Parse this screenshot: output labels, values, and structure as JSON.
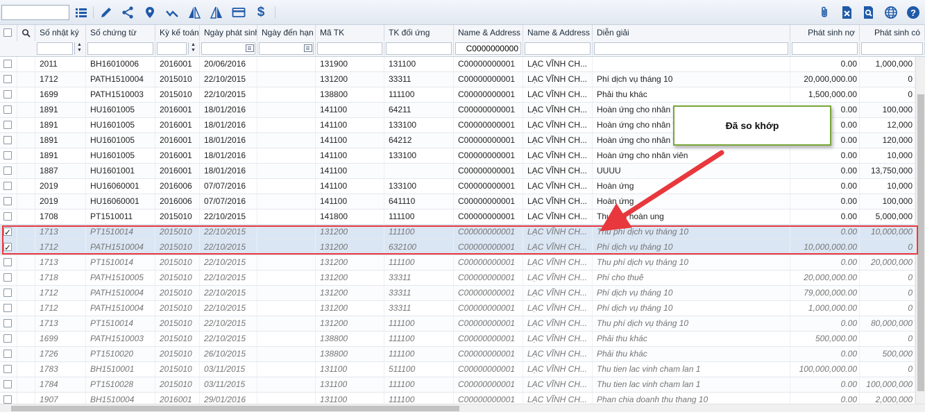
{
  "toolbar": {
    "search_value": "",
    "left_icons": [
      "list-icon",
      "edit-icon",
      "share-icon",
      "map-marker-icon",
      "check-mark-icon",
      "flip-left-icon",
      "flip-right-icon",
      "credit-card-icon",
      "dollar-icon"
    ],
    "right_icons": [
      "paperclip-icon",
      "excel-export-icon",
      "search-document-icon",
      "globe-icon",
      "help-icon"
    ]
  },
  "columns": {
    "so_nhat_ky": "Số nhật ký",
    "so_chung_tu": "Số chứng từ",
    "ky_ke_toan": "Kỳ kế toán",
    "ngay_phat_sinh": "Ngày phát sinh",
    "ngay_den_han": "Ngày đến hạn",
    "ma_tk": "Mã TK",
    "tk_doi_ung": "TK đối ứng",
    "name_address_1": "Name & Address",
    "name_address_2": "Name & Address",
    "dien_giai": "Diễn giải",
    "phat_sinh_no": "Phát sinh nợ",
    "phat_sinh_co": "Phát sinh có"
  },
  "filters": {
    "name_address_1": "C0000000000"
  },
  "rows": [
    {
      "checked": false,
      "faded": false,
      "nk": "2011",
      "ct": "BH16010006",
      "kkt": "2016001",
      "nps": "20/06/2016",
      "tk": "131900",
      "du": "131100",
      "na1": "C00000000001",
      "na2": "LẠC VĨNH CH...",
      "dg": "",
      "no": "0.00",
      "co": "1,000,000"
    },
    {
      "checked": false,
      "faded": false,
      "nk": "1712",
      "ct": "PATH1510004",
      "kkt": "2015010",
      "nps": "22/10/2015",
      "tk": "131200",
      "du": "33311",
      "na1": "C00000000001",
      "na2": "LẠC VĨNH CH...",
      "dg": "Phí dịch vụ tháng 10",
      "no": "20,000,000.00",
      "co": "0"
    },
    {
      "checked": false,
      "faded": false,
      "nk": "1699",
      "ct": "PATH1510003",
      "kkt": "2015010",
      "nps": "22/10/2015",
      "tk": "138800",
      "du": "111100",
      "na1": "C00000000001",
      "na2": "LẠC VĨNH CH...",
      "dg": "Phải thu khác",
      "no": "1,500,000.00",
      "co": "0"
    },
    {
      "checked": false,
      "faded": false,
      "nk": "1891",
      "ct": "HU1601005",
      "kkt": "2016001",
      "nps": "18/01/2016",
      "tk": "141100",
      "du": "64211",
      "na1": "C00000000001",
      "na2": "LẠC VĨNH CH...",
      "dg": "Hoàn ứng cho nhân viên",
      "no": "0.00",
      "co": "100,000"
    },
    {
      "checked": false,
      "faded": false,
      "nk": "1891",
      "ct": "HU1601005",
      "kkt": "2016001",
      "nps": "18/01/2016",
      "tk": "141100",
      "du": "133100",
      "na1": "C00000000001",
      "na2": "LẠC VĨNH CH...",
      "dg": "Hoàn ứng cho nhân viên",
      "no": "0.00",
      "co": "12,000"
    },
    {
      "checked": false,
      "faded": false,
      "nk": "1891",
      "ct": "HU1601005",
      "kkt": "2016001",
      "nps": "18/01/2016",
      "tk": "141100",
      "du": "64212",
      "na1": "C00000000001",
      "na2": "LẠC VĨNH CH...",
      "dg": "Hoàn ứng cho nhân viên",
      "no": "0.00",
      "co": "120,000"
    },
    {
      "checked": false,
      "faded": false,
      "nk": "1891",
      "ct": "HU1601005",
      "kkt": "2016001",
      "nps": "18/01/2016",
      "tk": "141100",
      "du": "133100",
      "na1": "C00000000001",
      "na2": "LẠC VĨNH CH...",
      "dg": "Hoàn ứng cho nhân viên",
      "no": "0.00",
      "co": "10,000"
    },
    {
      "checked": false,
      "faded": false,
      "nk": "1887",
      "ct": "HU1601001",
      "kkt": "2016001",
      "nps": "18/01/2016",
      "tk": "141100",
      "du": "",
      "na1": "C00000000001",
      "na2": "LẠC VĨNH CH...",
      "dg": "UUUU",
      "no": "0.00",
      "co": "13,750,000"
    },
    {
      "checked": false,
      "faded": false,
      "nk": "2019",
      "ct": "HU16060001",
      "kkt": "2016006",
      "nps": "07/07/2016",
      "tk": "141100",
      "du": "133100",
      "na1": "C00000000001",
      "na2": "LẠC VĨNH CH...",
      "dg": "Hoàn ứng",
      "no": "0.00",
      "co": "10,000"
    },
    {
      "checked": false,
      "faded": false,
      "nk": "2019",
      "ct": "HU16060001",
      "kkt": "2016006",
      "nps": "07/07/2016",
      "tk": "141100",
      "du": "641110",
      "na1": "C00000000001",
      "na2": "LẠC VĨNH CH...",
      "dg": "Hoàn ứng",
      "no": "0.00",
      "co": "100,000"
    },
    {
      "checked": false,
      "faded": false,
      "nk": "1708",
      "ct": "PT1510011",
      "kkt": "2015010",
      "nps": "22/10/2015",
      "tk": "141800",
      "du": "111100",
      "na1": "C00000000001",
      "na2": "LẠC VĨNH CH...",
      "dg": "Thu tiền hoàn ung",
      "no": "0.00",
      "co": "5,000,000"
    },
    {
      "checked": true,
      "faded": true,
      "nk": "1713",
      "ct": "PT1510014",
      "kkt": "2015010",
      "nps": "22/10/2015",
      "tk": "131200",
      "du": "111100",
      "na1": "C00000000001",
      "na2": "LẠC VĨNH CH...",
      "dg": "Thu phí dịch vụ tháng 10",
      "no": "0.00",
      "co": "10,000,000"
    },
    {
      "checked": true,
      "faded": true,
      "nk": "1712",
      "ct": "PATH1510004",
      "kkt": "2015010",
      "nps": "22/10/2015",
      "tk": "131200",
      "du": "632100",
      "na1": "C00000000001",
      "na2": "LẠC VĨNH CH...",
      "dg": "Phí dịch vụ tháng 10",
      "no": "10,000,000.00",
      "co": "0"
    },
    {
      "checked": false,
      "faded": true,
      "nk": "1713",
      "ct": "PT1510014",
      "kkt": "2015010",
      "nps": "22/10/2015",
      "tk": "131200",
      "du": "111100",
      "na1": "C00000000001",
      "na2": "LẠC VĨNH CH...",
      "dg": "Thu phí dịch vụ tháng 10",
      "no": "0.00",
      "co": "20,000,000"
    },
    {
      "checked": false,
      "faded": true,
      "nk": "1718",
      "ct": "PATH1510005",
      "kkt": "2015010",
      "nps": "22/10/2015",
      "tk": "131200",
      "du": "33311",
      "na1": "C00000000001",
      "na2": "LẠC VĨNH CH...",
      "dg": "Phí cho thuê",
      "no": "20,000,000.00",
      "co": "0"
    },
    {
      "checked": false,
      "faded": true,
      "nk": "1712",
      "ct": "PATH1510004",
      "kkt": "2015010",
      "nps": "22/10/2015",
      "tk": "131200",
      "du": "33311",
      "na1": "C00000000001",
      "na2": "LẠC VĨNH CH...",
      "dg": "Phí dịch vụ tháng 10",
      "no": "79,000,000.00",
      "co": "0"
    },
    {
      "checked": false,
      "faded": true,
      "nk": "1712",
      "ct": "PATH1510004",
      "kkt": "2015010",
      "nps": "22/10/2015",
      "tk": "131200",
      "du": "33311",
      "na1": "C00000000001",
      "na2": "LẠC VĨNH CH...",
      "dg": "Phí dịch vụ tháng 10",
      "no": "1,000,000.00",
      "co": "0"
    },
    {
      "checked": false,
      "faded": true,
      "nk": "1713",
      "ct": "PT1510014",
      "kkt": "2015010",
      "nps": "22/10/2015",
      "tk": "131200",
      "du": "111100",
      "na1": "C00000000001",
      "na2": "LẠC VĨNH CH...",
      "dg": "Thu phí dịch vụ tháng 10",
      "no": "0.00",
      "co": "80,000,000"
    },
    {
      "checked": false,
      "faded": true,
      "nk": "1699",
      "ct": "PATH1510003",
      "kkt": "2015010",
      "nps": "22/10/2015",
      "tk": "138800",
      "du": "111100",
      "na1": "C00000000001",
      "na2": "LẠC VĨNH CH...",
      "dg": "Phải thu khác",
      "no": "500,000.00",
      "co": "0"
    },
    {
      "checked": false,
      "faded": true,
      "nk": "1726",
      "ct": "PT1510020",
      "kkt": "2015010",
      "nps": "26/10/2015",
      "tk": "138800",
      "du": "111100",
      "na1": "C00000000001",
      "na2": "LẠC VĨNH CH...",
      "dg": "Phải thu khác",
      "no": "0.00",
      "co": "500,000"
    },
    {
      "checked": false,
      "faded": true,
      "nk": "1783",
      "ct": "BH1510001",
      "kkt": "2015010",
      "nps": "03/11/2015",
      "tk": "131100",
      "du": "511100",
      "na1": "C00000000001",
      "na2": "LẠC VĨNH CH...",
      "dg": "Thu tien lac vinh cham lan 1",
      "no": "100,000,000.00",
      "co": "0"
    },
    {
      "checked": false,
      "faded": true,
      "nk": "1784",
      "ct": "PT1510028",
      "kkt": "2015010",
      "nps": "03/11/2015",
      "tk": "131100",
      "du": "111100",
      "na1": "C00000000001",
      "na2": "LẠC VĨNH CH...",
      "dg": "Thu tien lac vinh cham lan 1",
      "no": "0.00",
      "co": "100,000,000"
    },
    {
      "checked": false,
      "faded": true,
      "nk": "1907",
      "ct": "BH1510004",
      "kkt": "2016001",
      "nps": "29/01/2016",
      "tk": "131100",
      "du": "111100",
      "na1": "C00000000001",
      "na2": "LẠC VĨNH CH...",
      "dg": "Phan chia doanh thu thang 10",
      "no": "0.00",
      "co": "2,000,000"
    }
  ],
  "annotation": {
    "callout_text": "Đã so khớp",
    "callout_border": "#78a63a",
    "highlight_color": "#e8383d",
    "arrow_color": "#e8383d"
  },
  "colors": {
    "toolbar_icon": "#1f5aa8",
    "selected_row": "#dbe6f4"
  }
}
